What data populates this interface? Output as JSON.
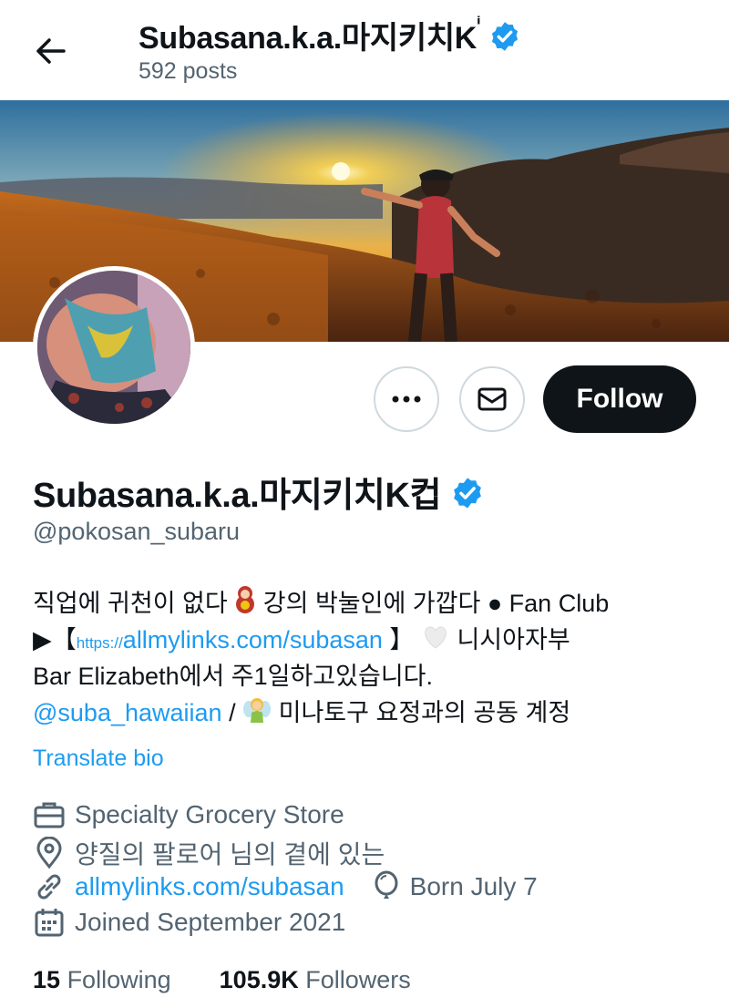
{
  "header": {
    "name": "Subasana.k.a.마지키치K",
    "name_suffix": "ⁱ",
    "posts": "592 posts"
  },
  "profile": {
    "display_name": "Subasana.k.a.마지키치K컵",
    "handle": "@pokosan_subaru",
    "follow_label": "Follow"
  },
  "bio": {
    "line1_a": "직업에 귀천이 없다",
    "line1_b": "강의 박눌인에 가깝다",
    "line1_c": "Fan Club",
    "line2_a": "▶【",
    "line2_proto": "https://",
    "line2_link": "allmylinks.com/subasan",
    "line2_b": "】",
    "line2_c": "니시아자부",
    "line3": "Bar Elizabeth에서 주1일하고있습니다.",
    "line4_mention": "@suba_hawaiian",
    "line4_sep": "/",
    "line4_b": "미나토구 요정과의 공동 계정",
    "translate": "Translate bio"
  },
  "meta": {
    "category": "Specialty Grocery Store",
    "location": "양질의 팔로어 님의 곁에 있는",
    "website": "allmylinks.com/subasan",
    "birthday": "Born July 7",
    "joined": "Joined September 2021"
  },
  "stats": {
    "following_count": "15",
    "following_label": "Following",
    "followers_count": "105.9K",
    "followers_label": "Followers"
  },
  "colors": {
    "accent": "#1d9bf0",
    "text": "#0f1419",
    "secondary": "#536471"
  },
  "icons": [
    "back-arrow-icon",
    "verified-badge-icon",
    "more-icon",
    "message-icon",
    "briefcase-icon",
    "location-pin-icon",
    "link-icon",
    "balloon-icon",
    "calendar-icon",
    "matryoshka-emoji",
    "white-heart-emoji",
    "fairy-emoji"
  ]
}
